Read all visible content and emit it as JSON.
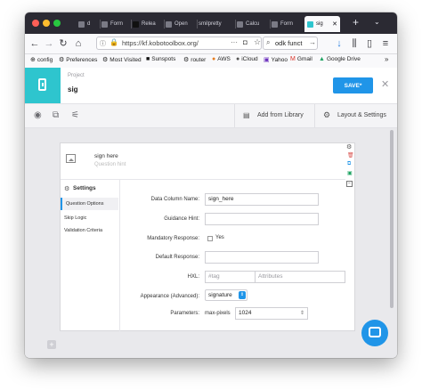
{
  "browser": {
    "tabs": [
      {
        "label": "d"
      },
      {
        "label": "Form"
      },
      {
        "label": "Relea"
      },
      {
        "label": "Open"
      },
      {
        "label": "smilpretty"
      },
      {
        "label": "Calcu"
      },
      {
        "label": "Form"
      },
      {
        "label": "sig",
        "active": true
      }
    ],
    "url": "https://kf.kobotoolbox.org/",
    "search_text": "odk funct",
    "bookmarks": [
      "config",
      "Preferences",
      "Most Visited",
      "Sunspots",
      "router",
      "AWS",
      "iCloud",
      "Yahoo",
      "Gmail",
      "Google Drive"
    ]
  },
  "header": {
    "project_label": "Project",
    "project_name": "sig",
    "save_label": "SAVE*"
  },
  "toolbar": {
    "add_from_library": "Add from Library",
    "layout_settings": "Layout & Settings"
  },
  "question": {
    "label": "sign here",
    "hint_placeholder": "Question hint"
  },
  "settings": {
    "title": "Settings",
    "menu": [
      {
        "label": "Question Options",
        "active": true
      },
      {
        "label": "Skip Logic"
      },
      {
        "label": "Validation Criteria"
      }
    ],
    "fields": {
      "data_column_name_label": "Data Column Name:",
      "data_column_name_value": "sign_here",
      "guidance_hint_label": "Guidance Hint:",
      "mandatory_label": "Mandatory Response:",
      "mandatory_option": "Yes",
      "default_label": "Default Response:",
      "hxl_label": "HXL:",
      "hxl_tag_placeholder": "#tag",
      "hxl_attr_placeholder": "Attributes",
      "appearance_label": "Appearance (Advanced):",
      "appearance_value": "signature",
      "parameters_label": "Parameters:",
      "max_pixels_label": "max-pixels",
      "max_pixels_value": "1024"
    }
  },
  "colors": {
    "accent": "#2ec5ce",
    "save_button": "#2095e8",
    "tab_bar": "#2b2a33"
  }
}
